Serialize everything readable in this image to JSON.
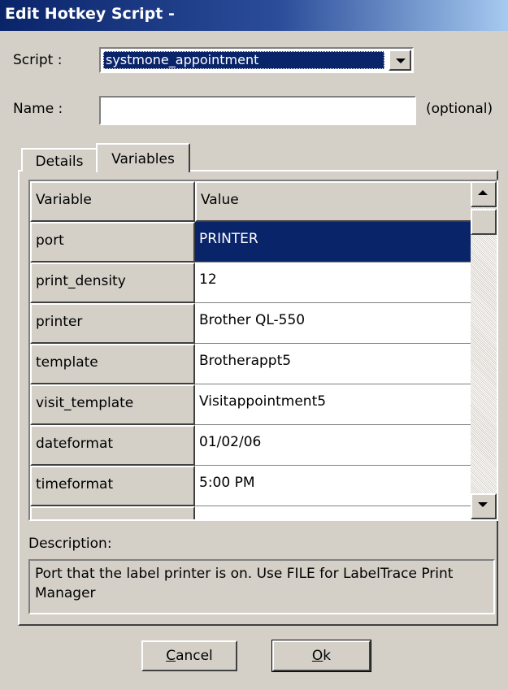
{
  "window": {
    "title": "Edit Hotkey Script -"
  },
  "script_field": {
    "label": "Script :",
    "value": "systmone_appointment"
  },
  "name_field": {
    "label": "Name :",
    "value": "",
    "hint": "(optional)"
  },
  "tabs": [
    {
      "label": "Details",
      "active": false
    },
    {
      "label": "Variables",
      "active": true
    }
  ],
  "grid": {
    "headers": {
      "variable": "Variable",
      "value": "Value"
    },
    "rows": [
      {
        "variable": "port",
        "value": "PRINTER",
        "selected": true
      },
      {
        "variable": "print_density",
        "value": "12"
      },
      {
        "variable": "printer",
        "value": "Brother QL-550"
      },
      {
        "variable": "template",
        "value": "Brotherappt5"
      },
      {
        "variable": "visit_template",
        "value": "Visitappointment5"
      },
      {
        "variable": "dateformat",
        "value": "01/02/06"
      },
      {
        "variable": "timeformat",
        "value": "5:00 PM"
      },
      {
        "variable": "",
        "value": ""
      }
    ]
  },
  "description": {
    "label": "Description:",
    "text": "Port that the label printer is on. Use FILE for LabelTrace Print Manager"
  },
  "buttons": {
    "cancel": {
      "label_accel": "C",
      "label_rest": "ancel"
    },
    "ok": {
      "label_accel": "O",
      "label_rest": "k"
    }
  },
  "colors": {
    "face": "#d4d0c8",
    "selection": "#0a246a",
    "title_start": "#0a246a",
    "title_end": "#a6caf0"
  },
  "icons": {
    "dropdown": "chevron-down-icon",
    "scroll_up": "arrow-up-icon",
    "scroll_down": "arrow-down-icon"
  }
}
